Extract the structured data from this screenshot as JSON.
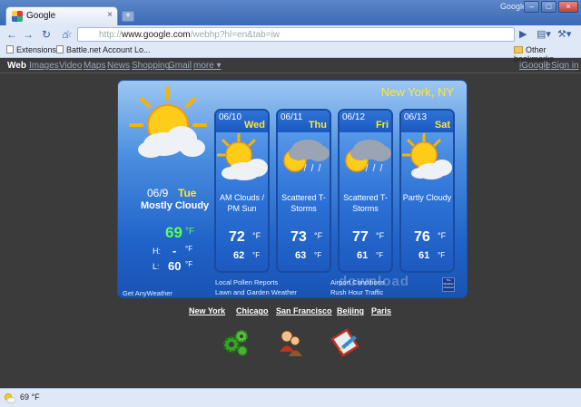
{
  "window": {
    "user_label": "Google",
    "tab_title": "Google",
    "tab_close": "×",
    "new_tab": "+",
    "min": "–",
    "max": "□",
    "close": "×"
  },
  "toolbar": {
    "url_prefix": "http://",
    "url_host": "www.google.com",
    "url_path": "/webhp?hl=en&tab=iw",
    "back_icon": "back-arrow-icon",
    "forward_icon": "forward-arrow-icon",
    "reload_icon": "reload-icon",
    "home_icon": "home-icon",
    "star_icon": "star-icon",
    "go_icon": "play-icon",
    "page_icon": "page-menu-icon",
    "wrench_icon": "wrench-icon"
  },
  "bookmarks": {
    "items": [
      "Extensions",
      "Battle.net Account Lo..."
    ],
    "other": "Other bookmarks"
  },
  "google_nav": {
    "items": [
      "Web",
      "Images",
      "Video",
      "Maps",
      "News",
      "Shopping",
      "Gmail",
      "more ▾"
    ],
    "right": [
      "iGoogle",
      "Sign in"
    ],
    "separator": "|"
  },
  "weather": {
    "city": "New York, NY",
    "today": {
      "date": "06/9",
      "day": "Tue",
      "condition": "Mostly Cloudy",
      "temp": "69",
      "unit": "°F",
      "high_label": "H:",
      "high": "-",
      "low_label": "L:",
      "low": "60",
      "hl_unit": "°F"
    },
    "forecast": [
      {
        "date": "06/10",
        "day": "Wed",
        "cond1": "AM Clouds /",
        "cond2": "PM Sun",
        "hi": "72",
        "lo": "62",
        "unit": "°F"
      },
      {
        "date": "06/11",
        "day": "Thu",
        "cond1": "Scattered T-",
        "cond2": "Storms",
        "hi": "73",
        "lo": "63",
        "unit": "°F"
      },
      {
        "date": "06/12",
        "day": "Fri",
        "cond1": "Scattered T-",
        "cond2": "Storms",
        "hi": "77",
        "lo": "61",
        "unit": "°F"
      },
      {
        "date": "06/13",
        "day": "Sat",
        "cond1": "Partly Cloudy",
        "cond2": "",
        "hi": "76",
        "lo": "61",
        "unit": "°F"
      }
    ],
    "links": {
      "get": "Get AnyWeather",
      "pollen": "Local Pollen Reports",
      "lawn": "Lawn and Garden Weather",
      "airport": "Airport Conditions",
      "rush": "Rush Hour Traffic"
    },
    "logo_text": "The Weather Channel",
    "watermark": "download"
  },
  "cities": [
    "New York",
    "Chicago",
    "San Francisco",
    "Beijing",
    "Paris"
  ],
  "status": {
    "text": "69 °F"
  },
  "colors": {
    "accent_yellow": "#ffe53a",
    "temp_green": "#5bff5b",
    "widget_blue": "#1f62c8"
  }
}
